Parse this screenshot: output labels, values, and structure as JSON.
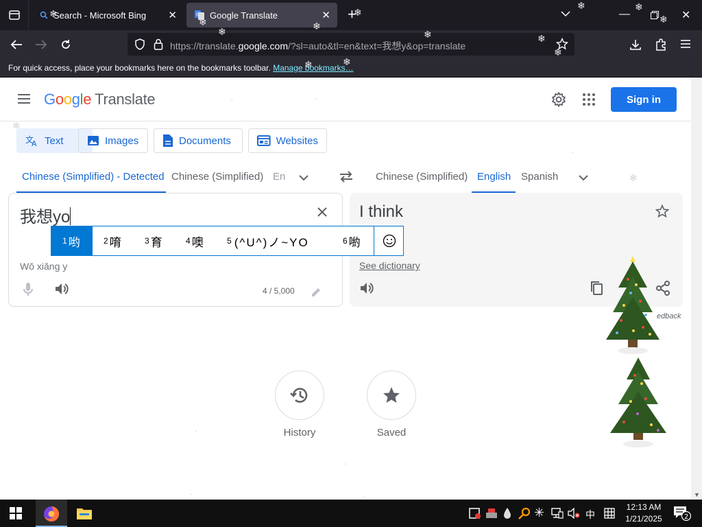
{
  "browser": {
    "tabs": [
      {
        "title": "Search - Microsoft Bing",
        "active": false
      },
      {
        "title": "Google Translate",
        "active": true
      }
    ],
    "url_prefix": "https://translate.",
    "url_domain": "google.com",
    "url_suffix": "/?sl=auto&tl=en&text=我想y&op=translate",
    "bookmark_hint": "For quick access, place your bookmarks here on the bookmarks toolbar.",
    "bookmark_link": "Manage bookmarks…"
  },
  "header": {
    "logo": "Google",
    "product": "Translate",
    "sign_in": "Sign in"
  },
  "modes": [
    {
      "label": "Text",
      "active": true
    },
    {
      "label": "Images"
    },
    {
      "label": "Documents"
    },
    {
      "label": "Websites"
    }
  ],
  "source_langs": [
    "Chinese (Simplified) - Detected",
    "Chinese (Simplified)",
    "En"
  ],
  "target_langs": [
    "Chinese (Simplified)",
    "English",
    "Spanish"
  ],
  "source": {
    "text": "我想yo",
    "romanization": "Wǒ xiǎng y",
    "char_count": "4 / 5,000"
  },
  "target": {
    "text": "I think",
    "see_dictionary": "See dictionary",
    "feedback": "edback"
  },
  "ime": {
    "candidates": [
      {
        "num": "1",
        "text": "哟"
      },
      {
        "num": "2",
        "text": "唷"
      },
      {
        "num": "3",
        "text": "育"
      },
      {
        "num": "4",
        "text": "噢"
      },
      {
        "num": "5",
        "text": "(^U^)ノ~YO"
      },
      {
        "num": "6",
        "text": "喲"
      }
    ]
  },
  "bottom": {
    "history": "History",
    "saved": "Saved"
  },
  "taskbar": {
    "ime_lang": "中",
    "time": "12:13 AM",
    "date": "1/21/2025",
    "notifications": "2"
  },
  "colors": {
    "accent": "#1a73e8",
    "ime_accent": "#0078d4",
    "chrome_dark": "#1c1b22"
  }
}
